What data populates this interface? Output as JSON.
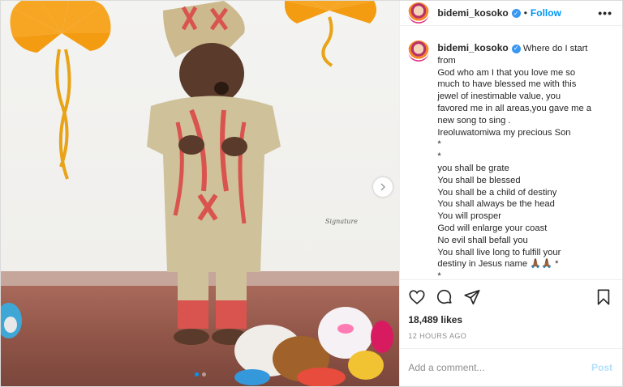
{
  "post": {
    "author": {
      "username": "bidemi_kosoko",
      "verified": true
    },
    "header": {
      "follow_label": "Follow",
      "separator": "•",
      "more_label": "•••"
    },
    "caption": {
      "username": "bidemi_kosoko",
      "lines": [
        "Where do I start",
        "from",
        "God who am I that you love me so",
        "much to have blessed me with this",
        "jewel of inestimable value, you",
        "favored me in all areas,you gave me a",
        "new song to sing .",
        "Ireoluwatomiwa my precious Son",
        "*",
        "*",
        "you shall be grate",
        "You shall be blessed",
        "You shall be a child of destiny",
        "You shall always be the head",
        "You will prosper",
        "God will enlarge your coast",
        "No evil shall befall you",
        "You shall live long to fulfill your",
        "destiny in Jesus name 🙏🏾🙏🏾 *",
        "*"
      ]
    },
    "media": {
      "watermark": "Signature",
      "carousel_count": 2,
      "carousel_active": 0
    },
    "likes": "18,489 likes",
    "timestamp": "12 HOURS AGO",
    "comment": {
      "placeholder": "Add a comment...",
      "value": "",
      "post_label": "Post"
    },
    "colors": {
      "accent": "#0095f6",
      "post_disabled": "#b2dffc",
      "verified": "#3897f0"
    }
  }
}
